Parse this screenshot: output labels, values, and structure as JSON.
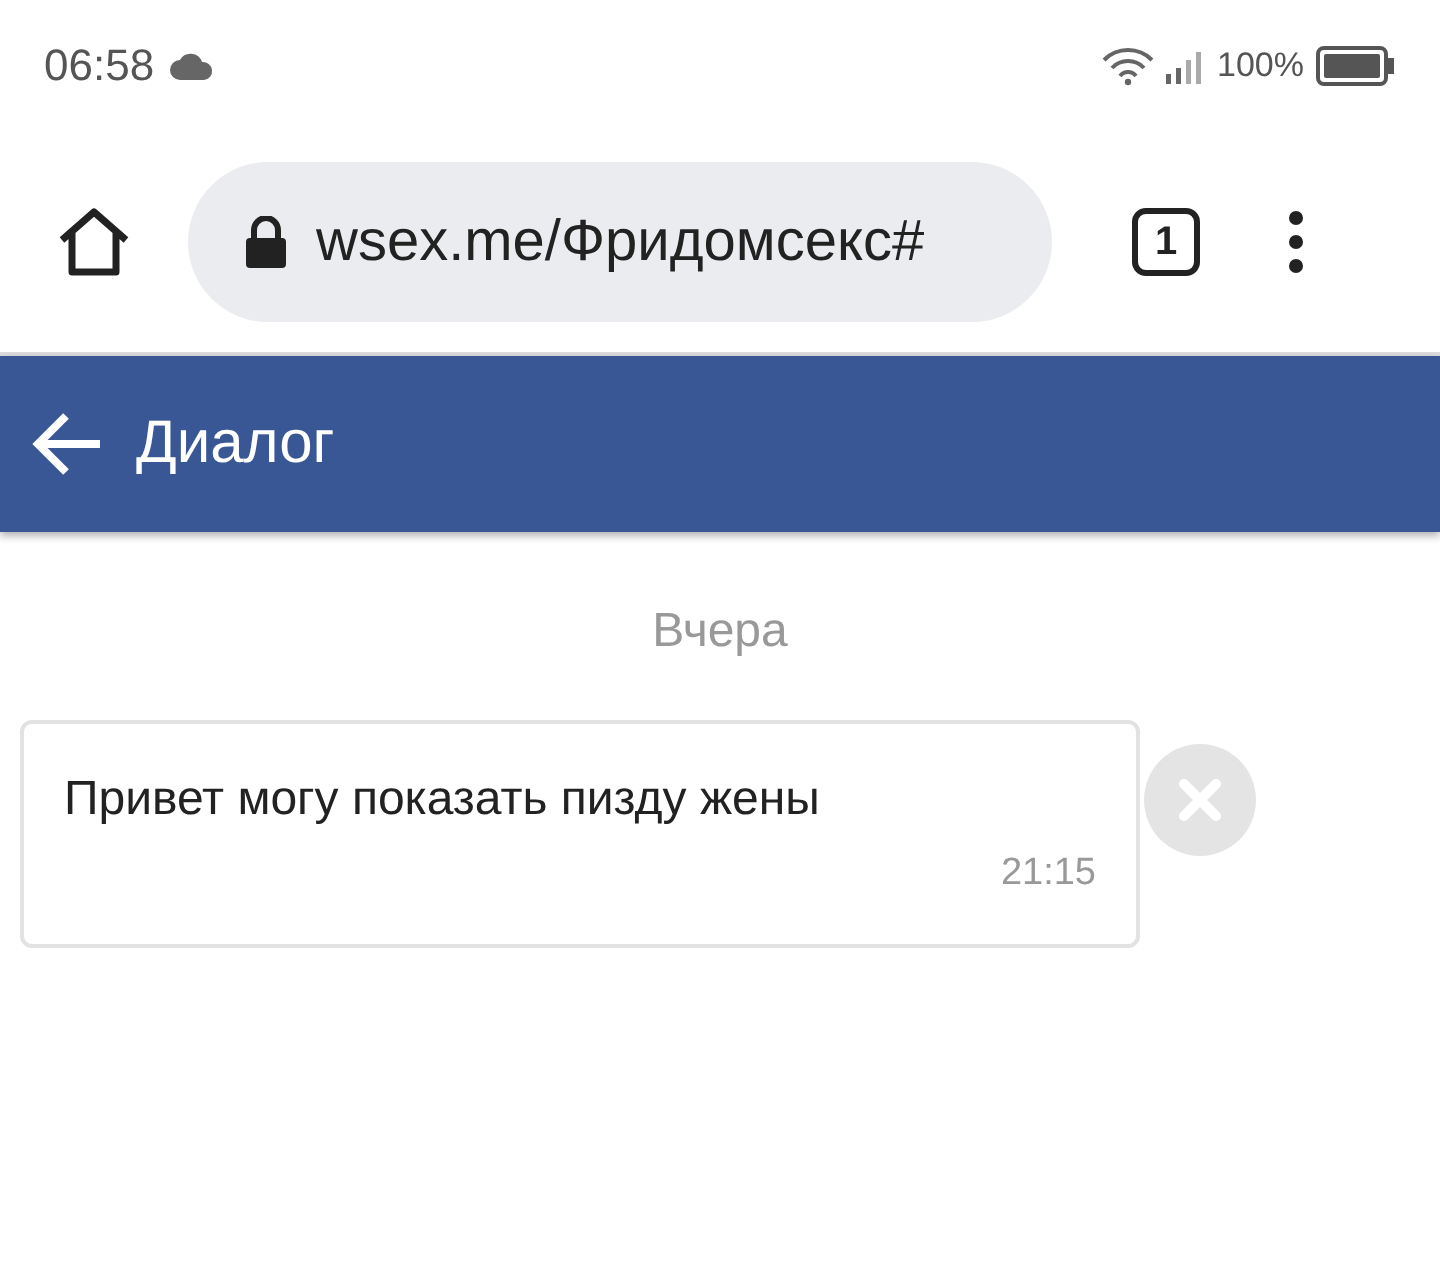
{
  "status_bar": {
    "time": "06:58",
    "battery": "100%"
  },
  "browser": {
    "url": "wsex.me/Фридомсекс#",
    "tab_count": "1"
  },
  "header": {
    "title": "Диалог"
  },
  "date_separator": "Вчера",
  "messages": [
    {
      "text": "Привет могу показать пизду жены",
      "time": "21:15"
    }
  ]
}
